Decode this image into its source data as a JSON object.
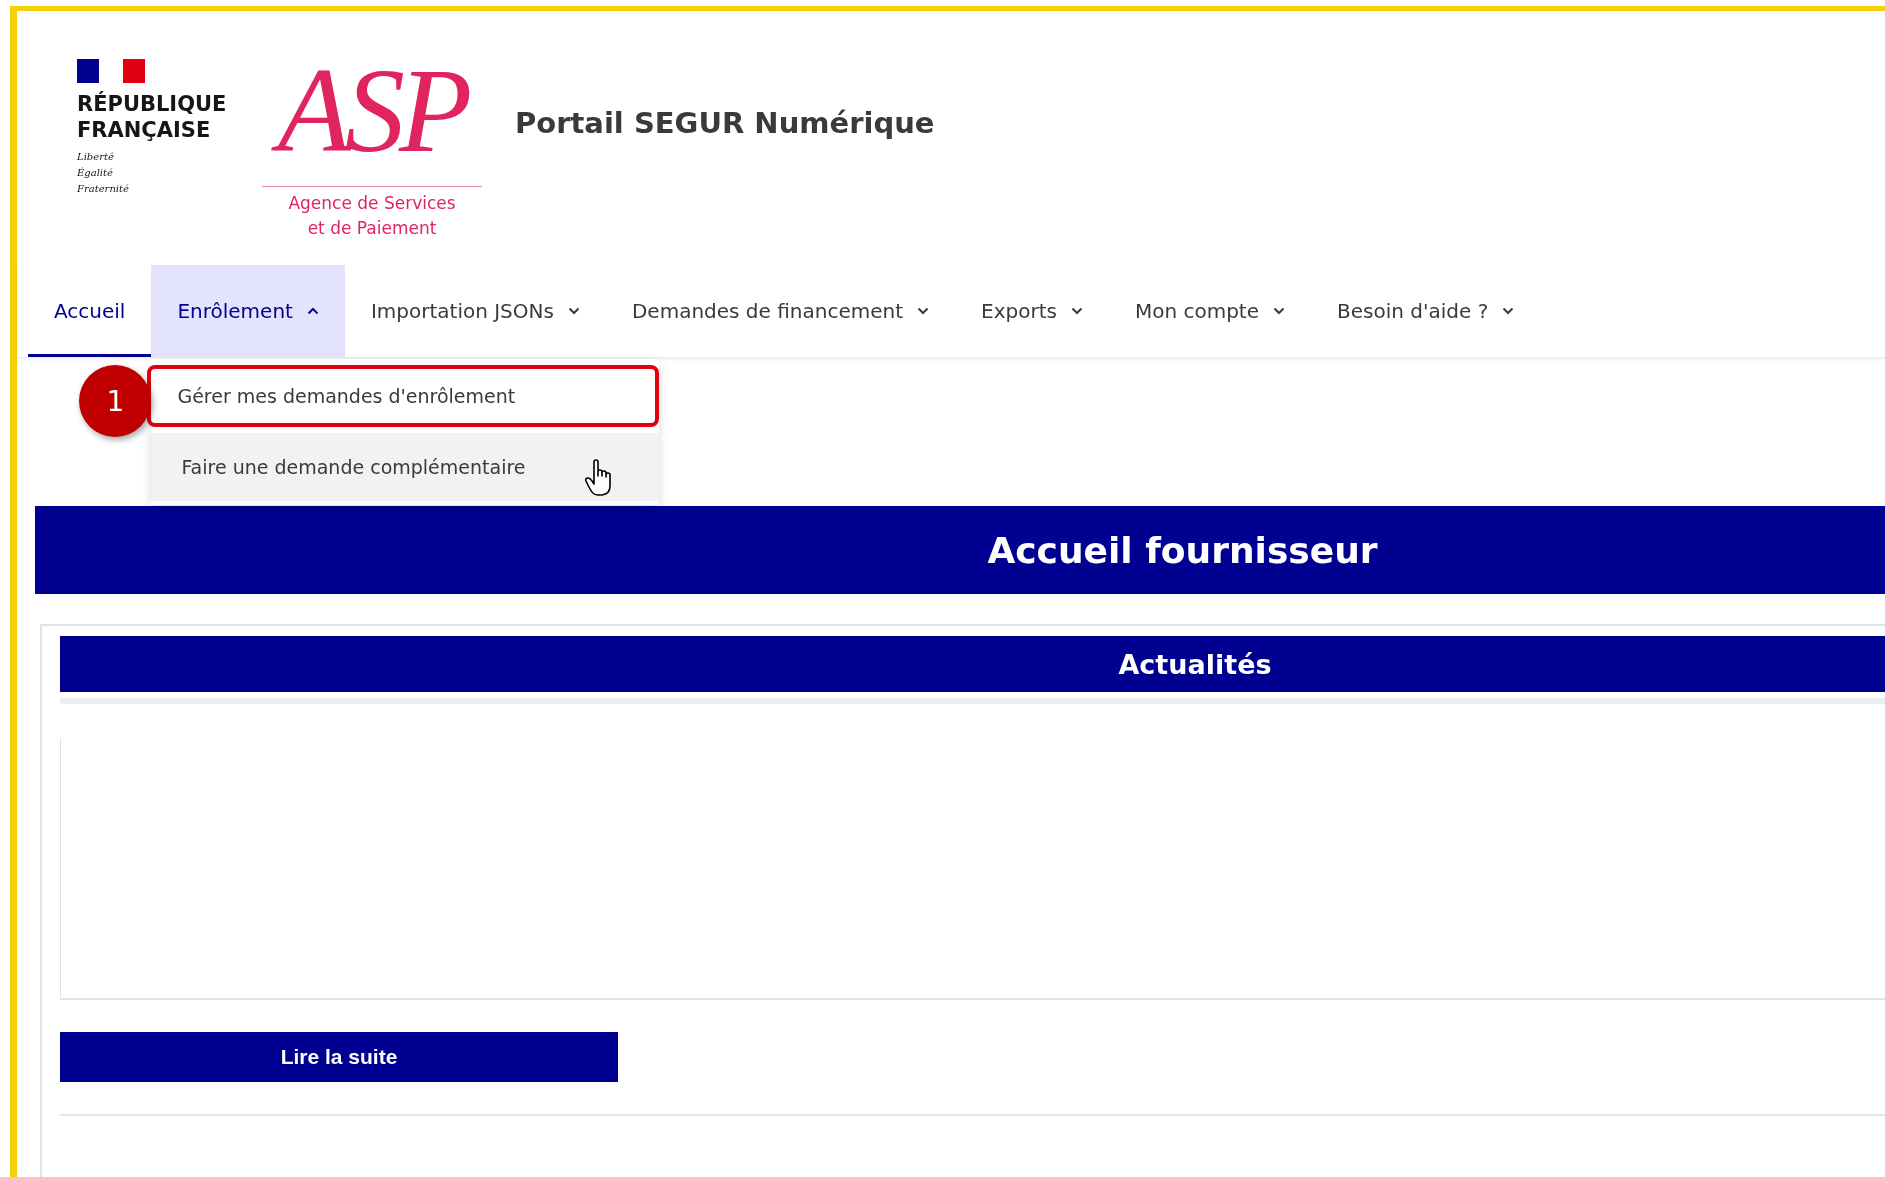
{
  "header": {
    "gov_logo": {
      "lines": [
        "RÉPUBLIQUE",
        "FRANÇAISE"
      ],
      "motto": [
        "Liberté",
        "Égalité",
        "Fraternité"
      ]
    },
    "asp_logo": {
      "mark": "ASP",
      "caption": [
        "Agence de Services",
        "et de Paiement"
      ]
    },
    "title": "Portail SEGUR Numérique"
  },
  "nav": [
    {
      "label": "Accueil",
      "selected": true,
      "dropdown": false,
      "expanded": false
    },
    {
      "label": "Enrôlement",
      "selected": false,
      "dropdown": true,
      "expanded": true
    },
    {
      "label": "Importation JSONs",
      "selected": false,
      "dropdown": true,
      "expanded": false
    },
    {
      "label": "Demandes de financement",
      "selected": false,
      "dropdown": true,
      "expanded": false
    },
    {
      "label": "Exports",
      "selected": false,
      "dropdown": true,
      "expanded": false
    },
    {
      "label": "Mon compte",
      "selected": false,
      "dropdown": true,
      "expanded": false
    },
    {
      "label": "Besoin d'aide ?",
      "selected": false,
      "dropdown": true,
      "expanded": false
    }
  ],
  "dropdown_menu": [
    {
      "label": "Gérer mes demandes d'enrôlement",
      "highlighted": true,
      "hovered": false
    },
    {
      "label": "Faire une demande complémentaire",
      "highlighted": false,
      "hovered": true
    }
  ],
  "callout": {
    "number": "1"
  },
  "banner": {
    "title": "Accueil fournisseur"
  },
  "news": {
    "title": "Actualités",
    "button": "Lire la suite"
  }
}
